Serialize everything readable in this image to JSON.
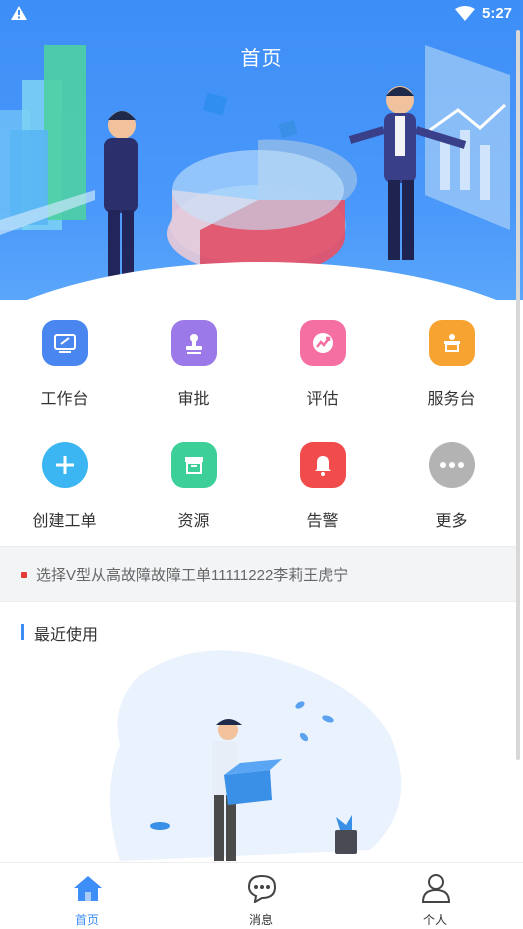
{
  "status_bar": {
    "time": "5:27"
  },
  "header": {
    "title": "首页"
  },
  "grid": {
    "items": [
      {
        "label": "工作台",
        "icon": "workbench-icon",
        "color": "#4a86f0"
      },
      {
        "label": "审批",
        "icon": "approval-stamp-icon",
        "color": "#9b79e8"
      },
      {
        "label": "评估",
        "icon": "assessment-icon",
        "color": "#f56fa3"
      },
      {
        "label": "服务台",
        "icon": "service-desk-icon",
        "color": "#f7a332"
      },
      {
        "label": "创建工单",
        "icon": "plus-icon",
        "color": "#3bb6f2"
      },
      {
        "label": "资源",
        "icon": "resource-box-icon",
        "color": "#3ccf98"
      },
      {
        "label": "告警",
        "icon": "alarm-bell-icon",
        "color": "#f24b4b"
      },
      {
        "label": "更多",
        "icon": "more-dots-icon",
        "color": "#b3b3b3"
      }
    ]
  },
  "notice": {
    "text": "选择V型从高故障故障工单11111222李莉王虎宁"
  },
  "recent": {
    "title": "最近使用"
  },
  "tabbar": {
    "tabs": [
      {
        "label": "首页",
        "icon": "home-icon",
        "active": true
      },
      {
        "label": "消息",
        "icon": "message-icon",
        "active": false
      },
      {
        "label": "个人",
        "icon": "person-icon",
        "active": false
      }
    ]
  },
  "colors": {
    "primary": "#3d8ef7",
    "notice_dot": "#e53935"
  }
}
